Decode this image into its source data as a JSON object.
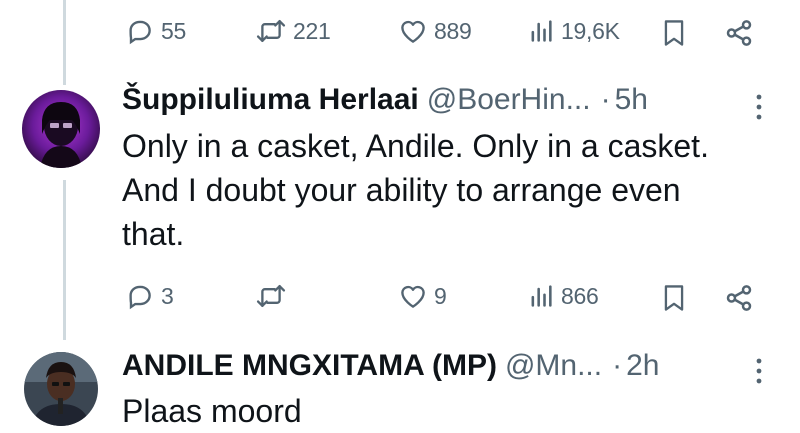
{
  "top_actions": {
    "replies": "55",
    "reposts": "221",
    "likes": "889",
    "views": "19,6K"
  },
  "tweet1": {
    "display_name": "Šuppiluliuma Herlaai",
    "handle": "@BoerHin...",
    "separator": "·",
    "time": "5h",
    "text_lines": [
      "Only in a casket, Andile. Only in a casket.",
      "And I doubt your ability to arrange even",
      "that."
    ],
    "actions": {
      "replies": "3",
      "reposts": "",
      "likes": "9",
      "views": "866"
    }
  },
  "tweet2": {
    "display_name": "ANDILE MNGXITAMA (MP)",
    "handle": "@Mn...",
    "separator": "·",
    "time": "2h",
    "text_lines": [
      "Plaas moord"
    ]
  },
  "colors": {
    "text_primary": "#0f1419",
    "text_secondary": "#536471",
    "thread_line": "#cfd9de"
  },
  "icons": [
    "reply-icon",
    "repost-icon",
    "like-icon",
    "views-icon",
    "bookmark-icon",
    "share-icon",
    "more-icon"
  ]
}
